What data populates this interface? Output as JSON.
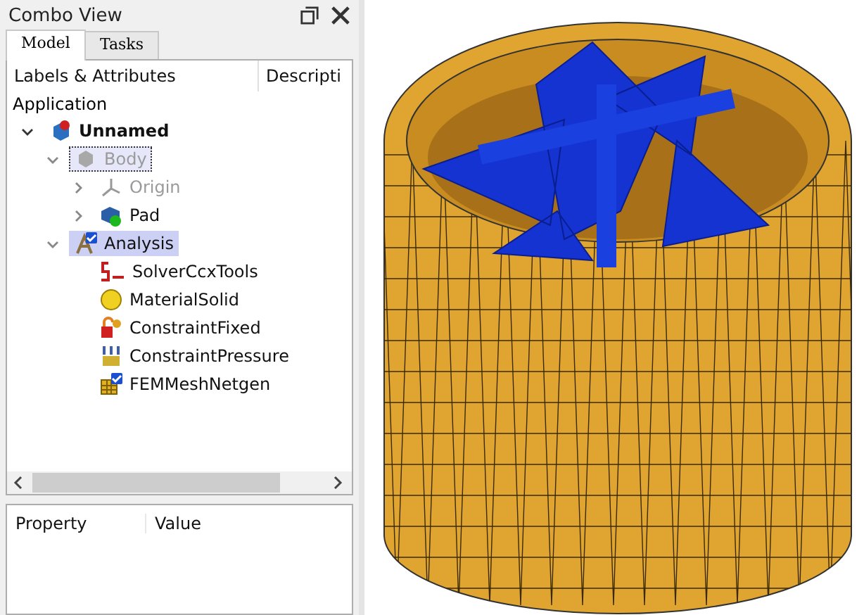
{
  "panel": {
    "title": "Combo View"
  },
  "tabs": [
    {
      "label": "Model",
      "selected": true
    },
    {
      "label": "Tasks",
      "selected": false
    }
  ],
  "tree": {
    "columns": [
      "Labels & Attributes",
      "Descripti"
    ],
    "root_label": "Application",
    "items": [
      {
        "label": "Unnamed",
        "kind": "document",
        "expanded": true,
        "selected": false,
        "focused": false,
        "hidden": false,
        "children": [
          {
            "label": "Body",
            "kind": "body",
            "expanded": true,
            "selected": false,
            "focused": true,
            "hidden": true,
            "children": [
              {
                "label": "Origin",
                "kind": "origin",
                "expanded": false,
                "selected": false,
                "focused": false,
                "hidden": true
              },
              {
                "label": "Pad",
                "kind": "pad",
                "expanded": false,
                "selected": false,
                "focused": false,
                "hidden": false
              }
            ]
          },
          {
            "label": "Analysis",
            "kind": "analysis",
            "expanded": true,
            "selected": true,
            "focused": false,
            "hidden": false,
            "children": [
              {
                "label": "SolverCcxTools",
                "kind": "solver",
                "selected": false,
                "focused": false,
                "hidden": false
              },
              {
                "label": "MaterialSolid",
                "kind": "material",
                "selected": false,
                "focused": false,
                "hidden": false
              },
              {
                "label": "ConstraintFixed",
                "kind": "fixed",
                "selected": false,
                "focused": false,
                "hidden": false
              },
              {
                "label": "ConstraintPressure",
                "kind": "pressure",
                "selected": false,
                "focused": false,
                "hidden": false
              },
              {
                "label": "FEMMeshNetgen",
                "kind": "mesh",
                "selected": false,
                "focused": false,
                "hidden": false
              }
            ]
          }
        ]
      }
    ]
  },
  "properties": {
    "columns": [
      "Property",
      "Value"
    ]
  }
}
